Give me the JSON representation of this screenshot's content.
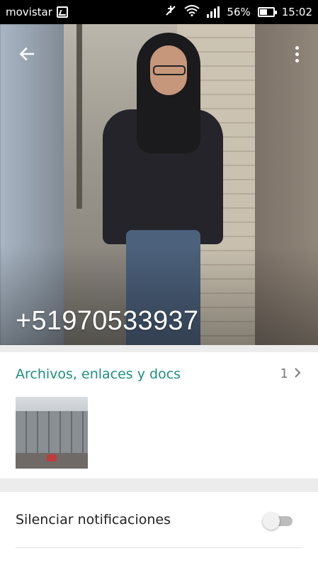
{
  "status_bar": {
    "carrier": "movistar",
    "battery": "56%",
    "battery_level": 0.56,
    "time": "15:02",
    "icons": [
      "image-icon",
      "mute-icon",
      "wifi-icon",
      "signal-icon",
      "battery-icon"
    ]
  },
  "header": {
    "contact_name": "+51970533937",
    "back_icon": "arrow-back-icon",
    "menu_icon": "more-vert-icon"
  },
  "media": {
    "title": "Archivos, enlaces y docs",
    "count": "1",
    "accent_color": "#1e8f80"
  },
  "settings": {
    "mute_label": "Silenciar notificaciones",
    "mute_enabled": false
  }
}
